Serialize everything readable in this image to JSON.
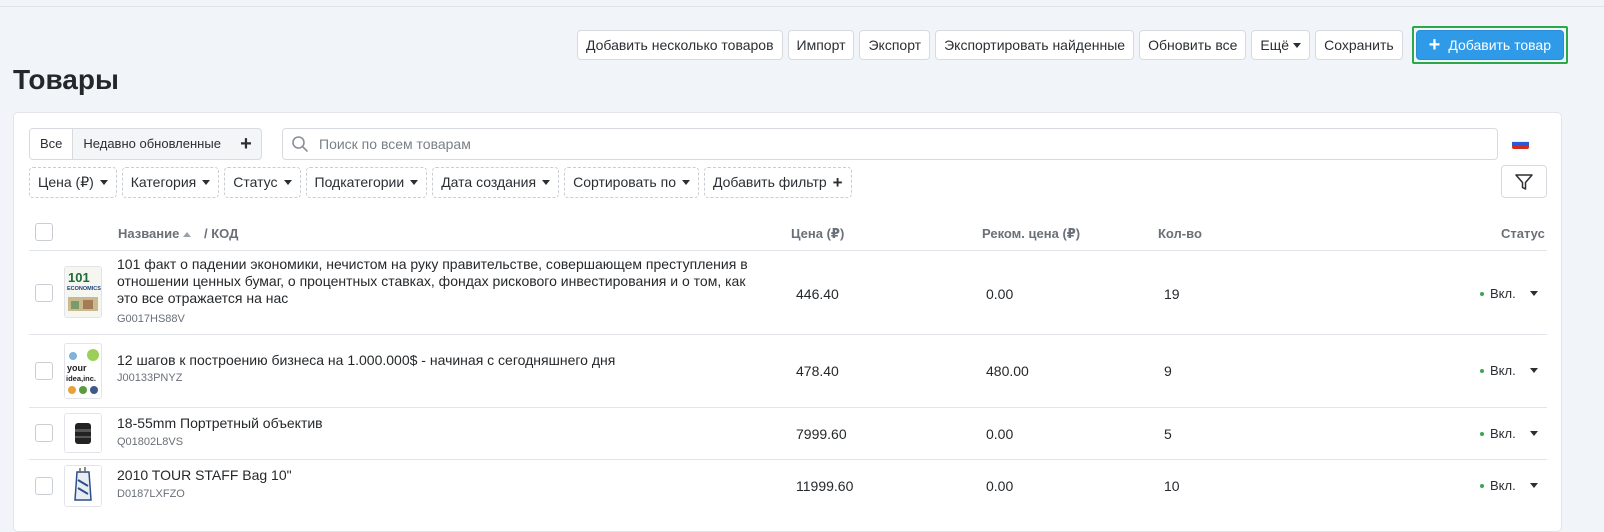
{
  "toolbar": {
    "buttons": [
      "Добавить несколько товаров",
      "Импорт",
      "Экспорт",
      "Экспортировать найденные",
      "Обновить все",
      "Ещё",
      "Сохранить"
    ],
    "add_label": "Добавить товар"
  },
  "page": {
    "title": "Товары"
  },
  "views": {
    "all": "Все",
    "recent": "Недавно обновленные"
  },
  "search": {
    "placeholder": "Поиск по всем товарам"
  },
  "filters": [
    "Цена (₽)",
    "Категория",
    "Статус",
    "Подкатегории",
    "Дата создания",
    "Сортировать по"
  ],
  "add_filter_label": "Добавить фильтр",
  "table": {
    "headers": {
      "name": "Название",
      "code": "/ КОД",
      "price": "Цена (₽)",
      "rec_price": "Реком. цена (₽)",
      "qty": "Кол-во",
      "status": "Статус"
    },
    "rows": [
      {
        "name": "101 факт о падении экономики, нечистом на руку правительстве, совершающем преступления в отношении ценных бумаг, о процентных ставках, фондах рискового инвестирования и о том, как это все отражается на нас",
        "code": "G0017HS88V",
        "price": "446.40",
        "rec_price": "0.00",
        "qty": "19",
        "status": "Вкл.",
        "thumb_text": "101 ECONOMICS"
      },
      {
        "name": "12 шагов к построению бизнеса на 1.000.000$ - начиная с сегодняшнего дня",
        "code": "J00133PNYZ",
        "price": "478.40",
        "rec_price": "480.00",
        "qty": "9",
        "status": "Вкл.",
        "thumb_text": "your idea, inc."
      },
      {
        "name": "18-55mm Портретный объектив",
        "code": "Q01802L8VS",
        "price": "7999.60",
        "rec_price": "0.00",
        "qty": "5",
        "status": "Вкл."
      },
      {
        "name": "2010 TOUR STAFF Bag 10\"",
        "code": "D0187LXFZO",
        "price": "11999.60",
        "rec_price": "0.00",
        "qty": "10",
        "status": "Вкл."
      }
    ]
  },
  "colors": {
    "accent": "#2f9ae8",
    "highlight": "#2aa84a",
    "status_on": "#3aa757"
  }
}
